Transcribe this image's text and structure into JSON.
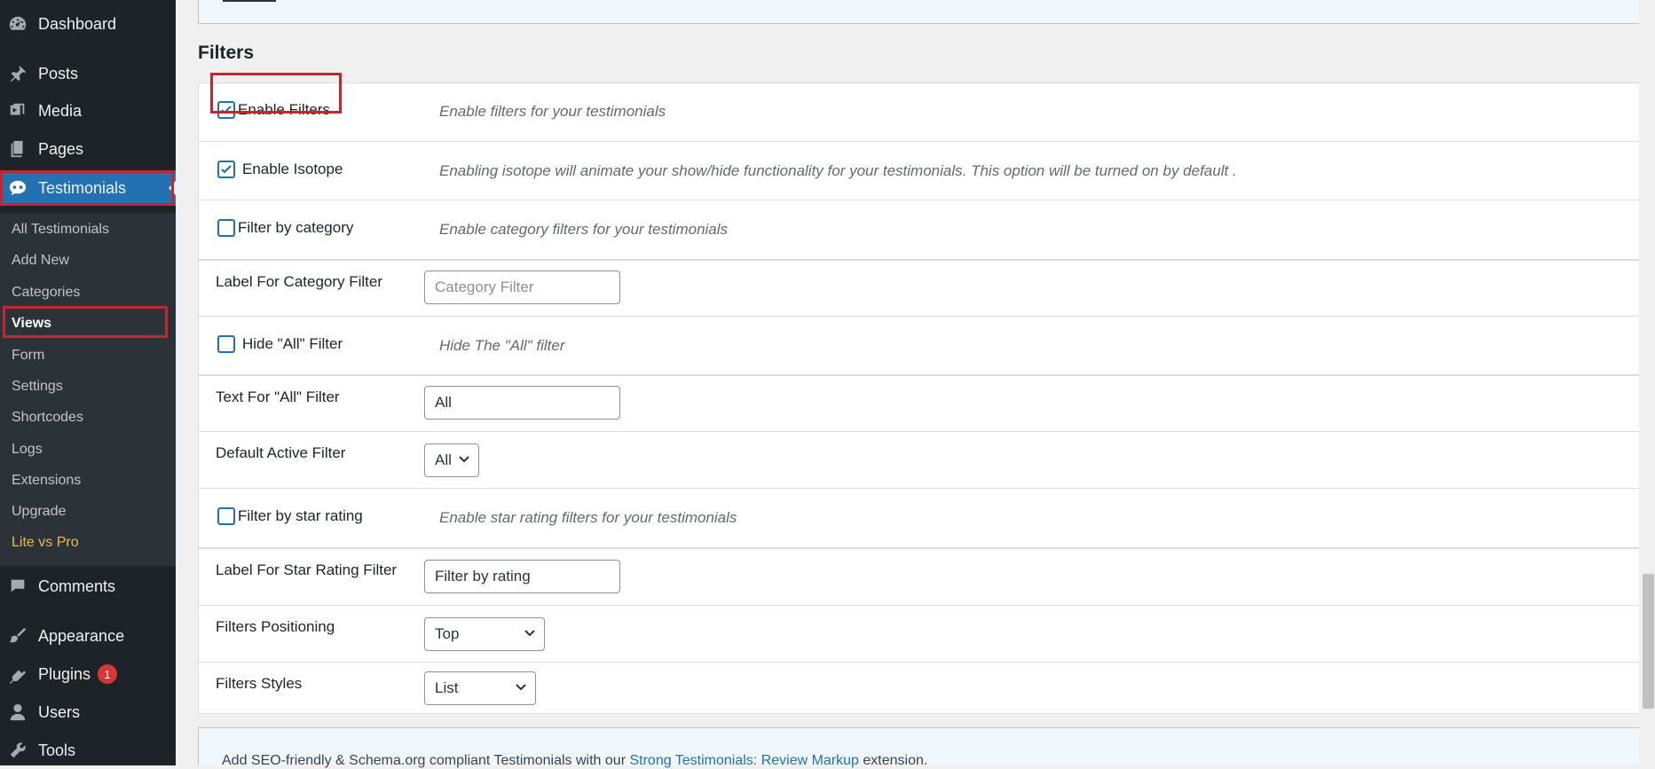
{
  "sidebar": {
    "dashboard": "Dashboard",
    "posts": "Posts",
    "media": "Media",
    "pages": "Pages",
    "testimonials": "Testimonials",
    "comments": "Comments",
    "appearance": "Appearance",
    "plugins": "Plugins",
    "plugins_badge": "1",
    "users": "Users",
    "tools": "Tools",
    "submenu": {
      "all": "All Testimonials",
      "add_new": "Add New",
      "categories": "Categories",
      "views": "Views",
      "form": "Form",
      "settings": "Settings",
      "shortcodes": "Shortcodes",
      "logs": "Logs",
      "extensions": "Extensions",
      "upgrade": "Upgrade",
      "lite_vs_pro": "Lite vs Pro"
    }
  },
  "section_title": "Filters",
  "filters": {
    "enable_filters": {
      "label": "Enable Filters",
      "checked": true,
      "desc": "Enable filters for your testimonials"
    },
    "enable_isotope": {
      "label": "Enable Isotope",
      "checked": true,
      "desc": "Enabling isotope will animate your show/hide functionality for your testimonials. This option will be turned on by default ."
    },
    "filter_category": {
      "label": "Filter by category",
      "checked": false,
      "desc": "Enable category filters for your testimonials"
    },
    "label_category": {
      "label": "Label For Category Filter",
      "placeholder": "Category Filter"
    },
    "hide_all": {
      "label": "Hide \"All\" Filter",
      "checked": false,
      "desc": "Hide The \"All\" filter"
    },
    "text_all": {
      "label": "Text For \"All\" Filter",
      "value": "All"
    },
    "default_active": {
      "label": "Default Active Filter",
      "value": "All"
    },
    "filter_star": {
      "label": "Filter by star rating",
      "checked": false,
      "desc": "Enable star rating filters for your testimonials"
    },
    "label_star": {
      "label": "Label For Star Rating Filter",
      "value": "Filter by rating"
    },
    "positioning": {
      "label": "Filters Positioning",
      "value": "Top"
    },
    "styles": {
      "label": "Filters Styles",
      "value": "List"
    }
  },
  "bottom_notice": {
    "prefix": "Add SEO-friendly & Schema.org compliant Testimonials with our ",
    "link": "Strong Testimonials: Review Markup",
    "suffix": " extension."
  },
  "colors": {
    "accent": "#2271b1",
    "highlight": "#c5252f",
    "sidebar": "#1d2327"
  }
}
